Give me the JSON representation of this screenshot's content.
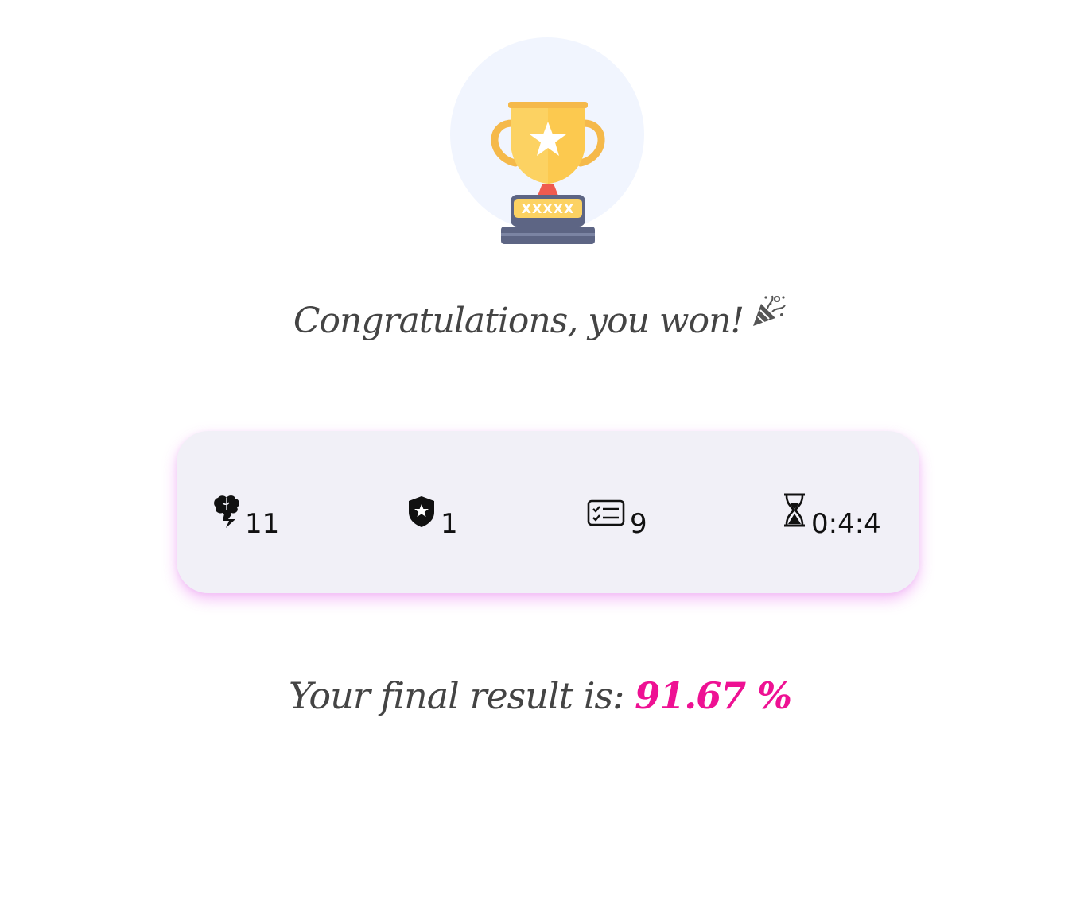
{
  "trophy": {
    "plate_text": "XXXXX",
    "icon": "trophy-icon"
  },
  "congrats": {
    "text": "Congratulations, you won!",
    "icon": "party-popper-icon"
  },
  "stats": [
    {
      "icon": "brain-icon",
      "value": "11"
    },
    {
      "icon": "shield-star-icon",
      "value": "1"
    },
    {
      "icon": "checklist-card-icon",
      "value": "9"
    },
    {
      "icon": "hourglass-icon",
      "value": "0:4:4"
    }
  ],
  "result": {
    "label": "Your final result is:",
    "score": "91.67 %"
  },
  "colors": {
    "score": "#ee1193",
    "card": "#f1f0f7",
    "card_glow": "#e878f0",
    "trophy_gold": "#fcc94f",
    "trophy_circle": "#f1f5fe"
  }
}
